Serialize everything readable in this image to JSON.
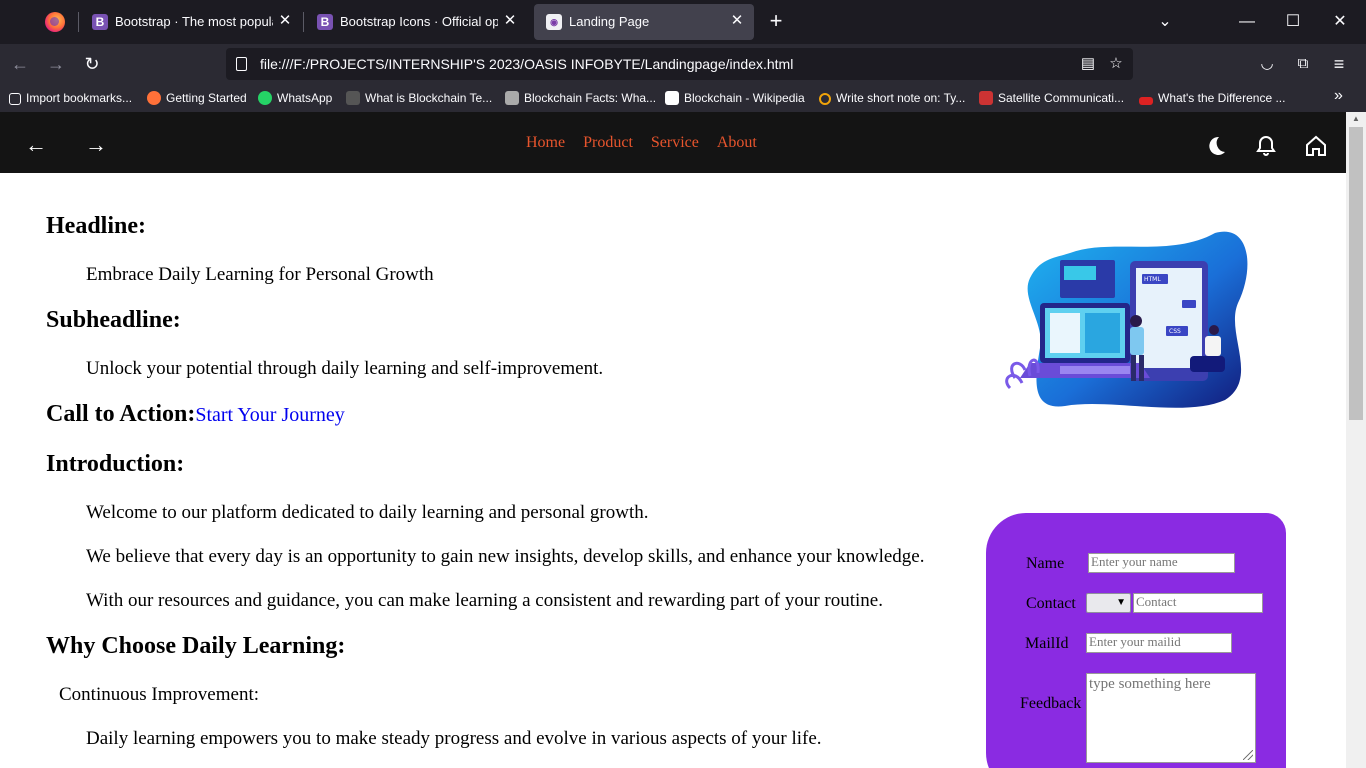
{
  "tabs": [
    {
      "title": "Bootstrap · The most popular H",
      "favicon": "B"
    },
    {
      "title": "Bootstrap Icons · Official open s",
      "favicon": "B"
    },
    {
      "title": "Landing Page",
      "favicon": "page-icon"
    }
  ],
  "url": "file:///F:/PROJECTS/INTERNSHIP'S 2023/OASIS INFOBYTE/Landingpage/index.html",
  "bookmarks": [
    {
      "label": "Import bookmarks...",
      "icon": "import-icon"
    },
    {
      "label": "Getting Started",
      "icon": "firefox-icon"
    },
    {
      "label": "WhatsApp",
      "icon": "whatsapp-icon"
    },
    {
      "label": "What is Blockchain Te...",
      "icon": "blockchain-icon"
    },
    {
      "label": "Blockchain Facts: Wha...",
      "icon": "blockchain-icon"
    },
    {
      "label": "Blockchain - Wikipedia",
      "icon": "wikipedia-icon"
    },
    {
      "label": "Write short note on: Ty...",
      "icon": "quiz-icon"
    },
    {
      "label": "Satellite Communicati...",
      "icon": "site-icon"
    },
    {
      "label": "What's the Difference ...",
      "icon": "jpt-icon"
    }
  ],
  "site_nav": {
    "menu": [
      "Home",
      "Product",
      "Service",
      "About"
    ]
  },
  "content": {
    "headline_heading": "Headline:",
    "headline_text": "Embrace Daily Learning for Personal Growth",
    "subheadline_heading": "Subheadline:",
    "subheadline_text": "Unlock your potential through daily learning and self-improvement.",
    "cta_heading": "Call to Action:",
    "cta_link": "Start Your Journey",
    "intro_heading": "Introduction:",
    "intro_paragraphs": [
      "Welcome to our platform dedicated to daily learning and personal growth.",
      "We believe that every day is an opportunity to gain new insights, develop skills, and enhance your knowledge.",
      "With our resources and guidance, you can make learning a consistent and rewarding part of your routine."
    ],
    "why_heading": "Why Choose Daily Learning:",
    "why_sub": "Continuous Improvement:",
    "why_text": "Daily learning empowers you to make steady progress and evolve in various aspects of your life."
  },
  "hero_labels": {
    "html": "HTML",
    "css": "CSS"
  },
  "form": {
    "name_label": "Name",
    "name_placeholder": "Enter your name",
    "contact_label": "Contact",
    "contact_placeholder": "Contact",
    "mail_label": "MailId",
    "mail_placeholder": "Enter your mailid",
    "feedback_label": "Feedback",
    "feedback_placeholder": "type something here"
  },
  "colors": {
    "form_bg": "#8a2be2",
    "menu": "#e8552d",
    "link": "#0000ee"
  }
}
